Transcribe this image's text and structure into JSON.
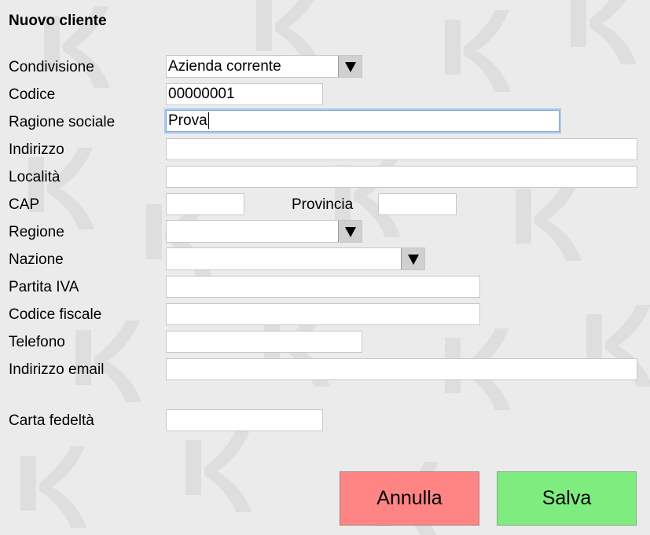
{
  "page": {
    "title": "Nuovo cliente"
  },
  "form": {
    "condivisione": {
      "label": "Condivisione",
      "value": "Azienda corrente"
    },
    "codice": {
      "label": "Codice",
      "value": "00000001"
    },
    "ragione_sociale": {
      "label": "Ragione sociale",
      "value": "Prova"
    },
    "indirizzo": {
      "label": "Indirizzo",
      "value": ""
    },
    "localita": {
      "label": "Località",
      "value": ""
    },
    "cap": {
      "label": "CAP",
      "value": ""
    },
    "provincia": {
      "label": "Provincia",
      "value": ""
    },
    "regione": {
      "label": "Regione",
      "value": ""
    },
    "nazione": {
      "label": "Nazione",
      "value": ""
    },
    "partita_iva": {
      "label": "Partita IVA",
      "value": ""
    },
    "codice_fiscale": {
      "label": "Codice fiscale",
      "value": ""
    },
    "telefono": {
      "label": "Telefono",
      "value": ""
    },
    "email": {
      "label": "Indirizzo email",
      "value": ""
    },
    "carta_fedelta": {
      "label": "Carta fedeltà",
      "value": ""
    }
  },
  "buttons": {
    "cancel": "Annulla",
    "save": "Salva"
  },
  "colors": {
    "cancel": "#ff8585",
    "save": "#7eec7e",
    "focus": "#a9c8ee",
    "background": "#ebebeb"
  },
  "icons": {
    "dropdown": "triangle-down-icon",
    "watermark": "logo-watermark"
  }
}
